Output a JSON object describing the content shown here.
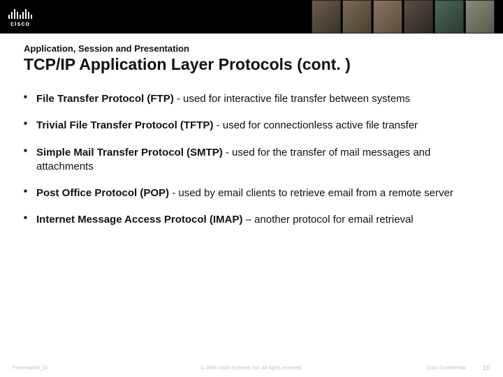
{
  "brand": "cisco",
  "header": {
    "pretitle": "Application, Session and Presentation",
    "title": "TCP/IP Application Layer Protocols (cont. )"
  },
  "bullets": [
    {
      "bold": "File Transfer Protocol (FTP)",
      "rest": " - used for interactive file transfer between systems"
    },
    {
      "bold": "Trivial File Transfer Protocol (TFTP)",
      "rest": " - used for connectionless active file transfer"
    },
    {
      "bold": "Simple Mail Transfer Protocol (SMTP)",
      "rest": " - used for the transfer of mail messages and attachments"
    },
    {
      "bold": "Post Office Protocol (POP)",
      "rest": "  - used by email clients to retrieve email from a remote server"
    },
    {
      "bold": "Internet Message Access Protocol (IMAP)",
      "rest": " – another protocol for email retrieval"
    }
  ],
  "footer": {
    "left": "Presentation_ID",
    "center": "© 2008 Cisco Systems, Inc. All rights reserved.",
    "confidential": "Cisco Confidential",
    "page": "10"
  }
}
